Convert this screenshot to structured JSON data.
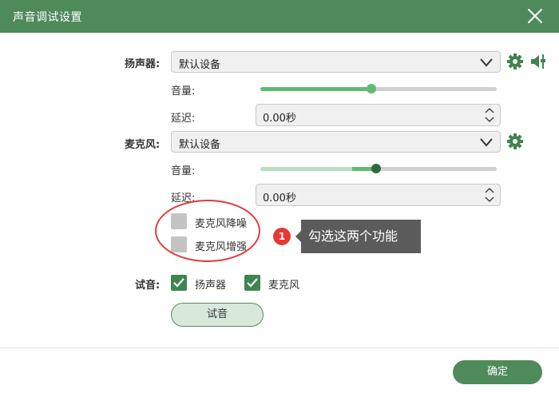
{
  "window": {
    "title": "声音调试设置"
  },
  "speaker": {
    "label": "扬声器:",
    "device": "默认设备",
    "volume_label": "音量:",
    "volume": 0.47,
    "delay_label": "延迟:",
    "delay_value": "0.00秒"
  },
  "microphone": {
    "label": "麦克风:",
    "device": "默认设备",
    "volume_label": "音量:",
    "volume": 0.49,
    "level": 0.39,
    "delay_label": "延迟:",
    "delay_value": "0.00秒"
  },
  "options": {
    "noise_reduction": {
      "label": "麦克风降噪",
      "checked": false
    },
    "boost": {
      "label": "麦克风增强",
      "checked": false
    }
  },
  "annotation": {
    "number": "1",
    "text": "勾选这两个功能"
  },
  "test": {
    "label": "试音:",
    "speaker_label": "扬声器",
    "speaker_checked": true,
    "mic_label": "麦克风",
    "mic_checked": true,
    "button": "试音"
  },
  "footer": {
    "ok_button": "确定"
  },
  "colors": {
    "brand": "#4f8a5b",
    "slider_fill": "#5fbb71",
    "checkbox_on": "#3f8451",
    "annotation": "#e03c3c"
  }
}
